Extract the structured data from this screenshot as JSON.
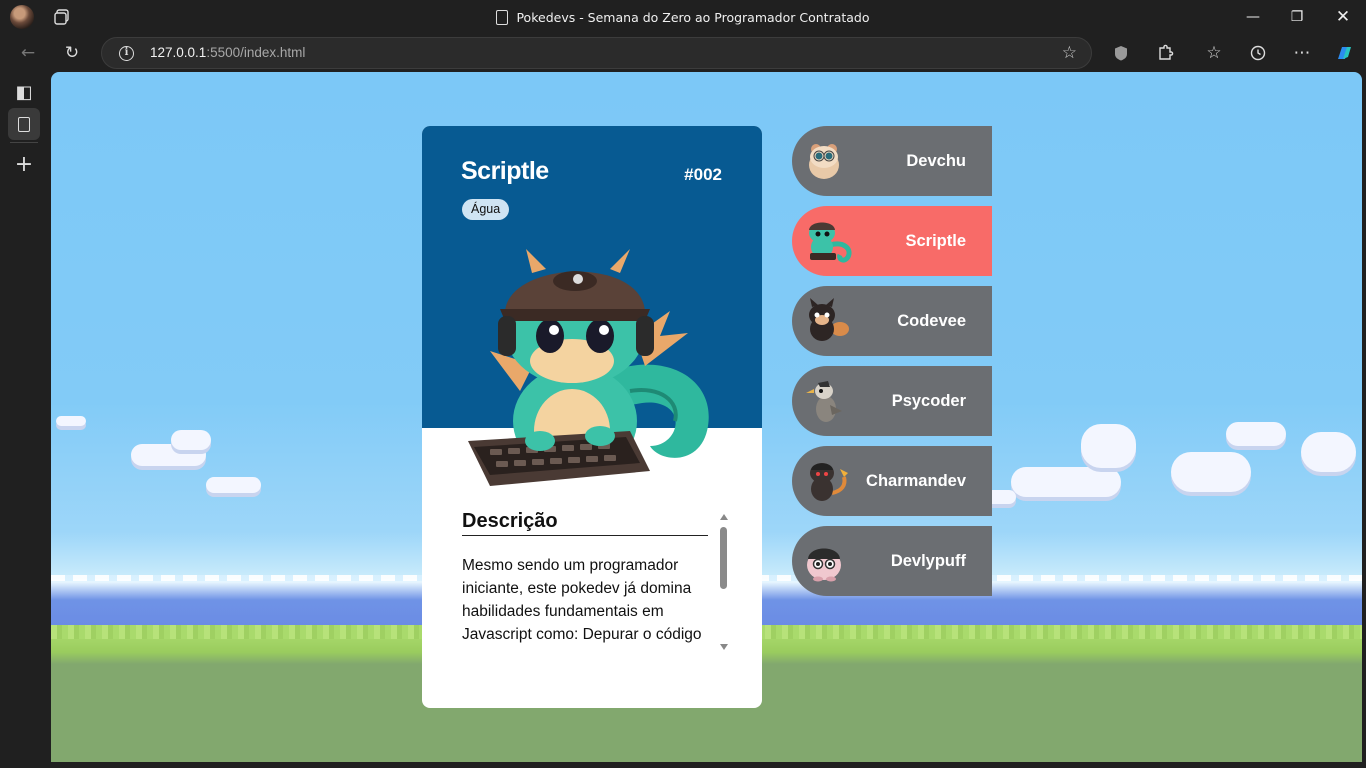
{
  "browser": {
    "tab_title": "Pokedevs - Semana do Zero ao Programador Contratado",
    "url_host": "127.0.0.1",
    "url_rest": ":5500/index.html"
  },
  "card": {
    "name": "Scriptle",
    "number": "#002",
    "type": "Água",
    "color": "#075a92",
    "description_title": "Descrição",
    "description": "Mesmo sendo um programador iniciante, este pokedev já domina habilidades fundamentais em Javascript como: Depurar o código"
  },
  "pokemon_list": [
    {
      "name": "Devchu",
      "icon": "hamster-icon",
      "active": false
    },
    {
      "name": "Scriptle",
      "icon": "dragon-icon",
      "active": true
    },
    {
      "name": "Codevee",
      "icon": "fox-icon",
      "active": false
    },
    {
      "name": "Psycoder",
      "icon": "bird-icon",
      "active": false
    },
    {
      "name": "Charmandev",
      "icon": "lizard-icon",
      "active": false
    },
    {
      "name": "Devlypuff",
      "icon": "puff-icon",
      "active": false
    }
  ],
  "colors": {
    "list_default": "#6b6e72",
    "list_active": "#f86b68"
  }
}
